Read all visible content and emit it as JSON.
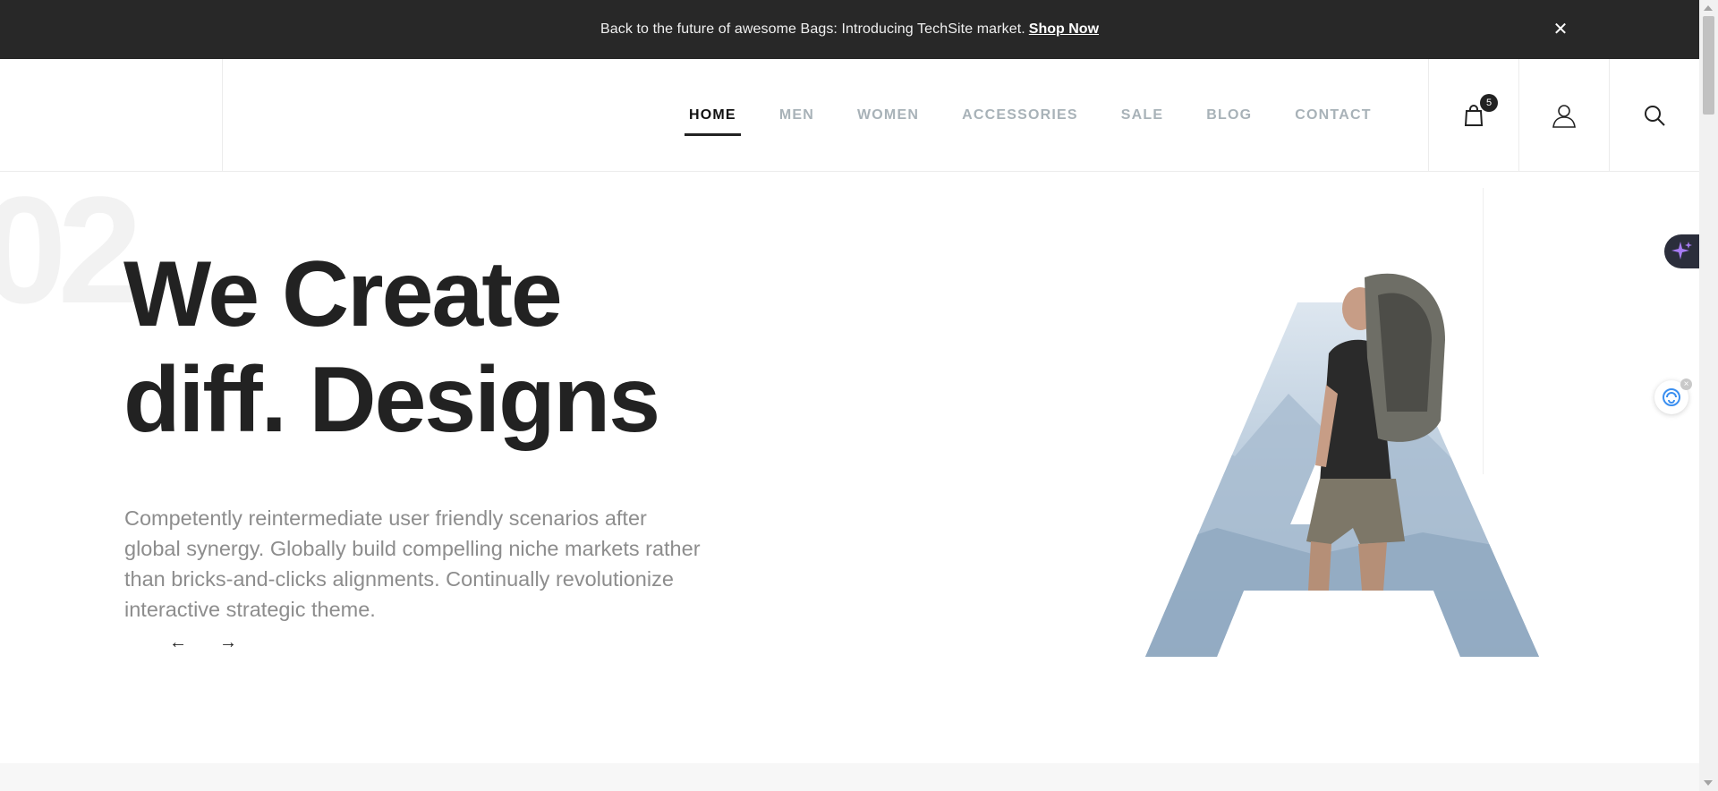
{
  "announcement": {
    "text": "Back to the future of awesome Bags: Introducing TechSite market.",
    "link": "Shop Now",
    "close_glyph": "✕"
  },
  "nav": {
    "items": [
      {
        "label": "HOME",
        "active": true
      },
      {
        "label": "MEN"
      },
      {
        "label": "WOMEN"
      },
      {
        "label": "ACCESSORIES"
      },
      {
        "label": "SALE"
      },
      {
        "label": "BLOG"
      },
      {
        "label": "CONTACT"
      }
    ]
  },
  "header_icons": {
    "cart_icon": "shopping-bag-icon",
    "cart_count": "5",
    "account_icon": "user-icon",
    "search_icon": "search-icon"
  },
  "hero": {
    "slide_number": "02",
    "title_line1": "We Create",
    "title_line2": "diff. Designs",
    "description": "Competently reintermediate user friendly scenarios after global synergy. Globally build compelling niche markets rather than bricks-and-clicks alignments. Continually revolutionize interactive strategic theme.",
    "prev_glyph": "←",
    "next_glyph": "→"
  },
  "widgets": {
    "sparkle_icon": "sparkle-icon",
    "chat_icon": "chat-assistant-icon",
    "chat_close": "×"
  },
  "colors": {
    "topbar": "#282828",
    "nav_inactive": "#a8b2b8",
    "nav_active": "#111111",
    "sky": "#b9cbdc"
  }
}
